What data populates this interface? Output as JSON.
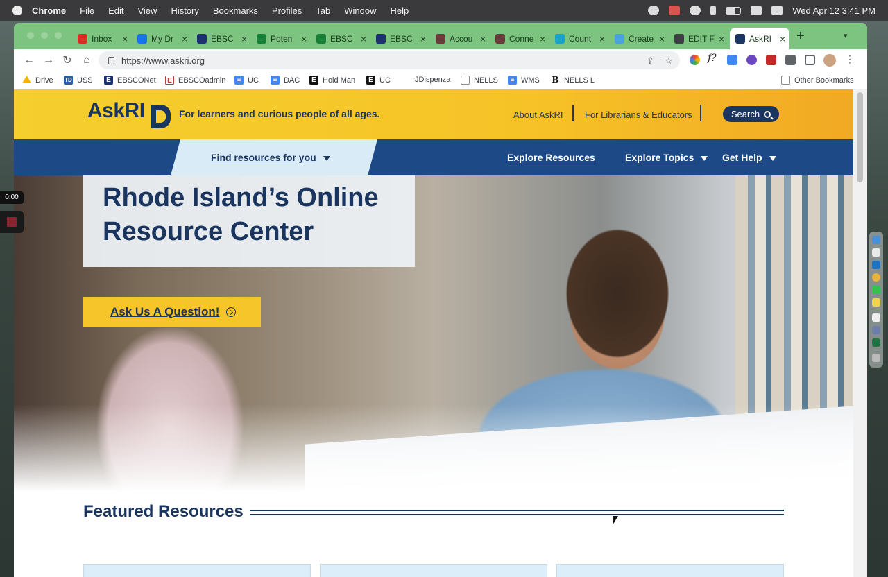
{
  "menubar": {
    "app": "Chrome",
    "items": [
      "File",
      "Edit",
      "View",
      "History",
      "Bookmarks",
      "Profiles",
      "Tab",
      "Window",
      "Help"
    ],
    "clock": "Wed Apr 12  3:41 PM"
  },
  "tabs": [
    {
      "label": "Inbox",
      "color": "#d93025"
    },
    {
      "label": "My Dr",
      "color": "#1a73e8"
    },
    {
      "label": "EBSC",
      "color": "#1c2f6e"
    },
    {
      "label": "Poten",
      "color": "#188038"
    },
    {
      "label": "EBSC",
      "color": "#188038"
    },
    {
      "label": "EBSC",
      "color": "#1c2f6e"
    },
    {
      "label": "Accou",
      "color": "#6b3a3a"
    },
    {
      "label": "Conne",
      "color": "#6b3a3a"
    },
    {
      "label": "Count",
      "color": "#1aa3c9"
    },
    {
      "label": "Create",
      "color": "#4aa3df"
    },
    {
      "label": "EDIT F",
      "color": "#3c4043"
    },
    {
      "label": "AskRI",
      "color": "#1a355f"
    }
  ],
  "toolbar": {
    "url": "https://www.askri.org",
    "nav_back": "←",
    "nav_forward": "→",
    "nav_reload": "↻",
    "nav_home": "⌂"
  },
  "bookmarks": [
    {
      "label": "Drive",
      "icon": "drive-icon",
      "bg": "#f4b400",
      "glyph": ""
    },
    {
      "label": "USS",
      "icon": "td-icon",
      "bg": "#2a5db0",
      "glyph": "TD"
    },
    {
      "label": "EBSCONet",
      "icon": "ebsco-icon",
      "bg": "#1c2f6e",
      "glyph": "E"
    },
    {
      "label": "EBSCOadmin",
      "icon": "ebsco-admin-icon",
      "bg": "#b43d3d",
      "glyph": "E"
    },
    {
      "label": "UC",
      "icon": "doc-icon",
      "bg": "#4285f4",
      "glyph": "≡"
    },
    {
      "label": "DAC",
      "icon": "doc-icon",
      "bg": "#4285f4",
      "glyph": "≡"
    },
    {
      "label": "Hold Man",
      "icon": "ebsco-icon",
      "bg": "#111",
      "glyph": "E"
    },
    {
      "label": "UC",
      "icon": "ebsco-icon",
      "bg": "#111",
      "glyph": "E"
    },
    {
      "label": "JDispenza",
      "icon": "",
      "bg": "transparent",
      "glyph": ""
    },
    {
      "label": "NELLS",
      "icon": "folder-icon",
      "bg": "#8a8a8a",
      "glyph": ""
    },
    {
      "label": "WMS",
      "icon": "doc-icon",
      "bg": "#4285f4",
      "glyph": "≡"
    },
    {
      "label": "NELLS L",
      "icon": "b-icon",
      "bg": "transparent",
      "glyph": "B"
    },
    {
      "label": "Other Bookmarks",
      "icon": "folder-icon",
      "bg": "#8a8a8a",
      "glyph": ""
    }
  ],
  "site": {
    "logo": "AskRI",
    "tagline": "For learners and curious people of all ages.",
    "about": "About AskRI",
    "librarians": "For Librarians & Educators",
    "search": "Search",
    "find": "Find resources for you",
    "explore_resources": "Explore Resources",
    "explore_topics": "Explore Topics",
    "get_help": "Get Help",
    "hero_title": "Rhode Island’s Online Resource Center",
    "ask": "Ask Us A Question!",
    "featured": "Featured Resources"
  },
  "video": {
    "time": "0:00"
  }
}
